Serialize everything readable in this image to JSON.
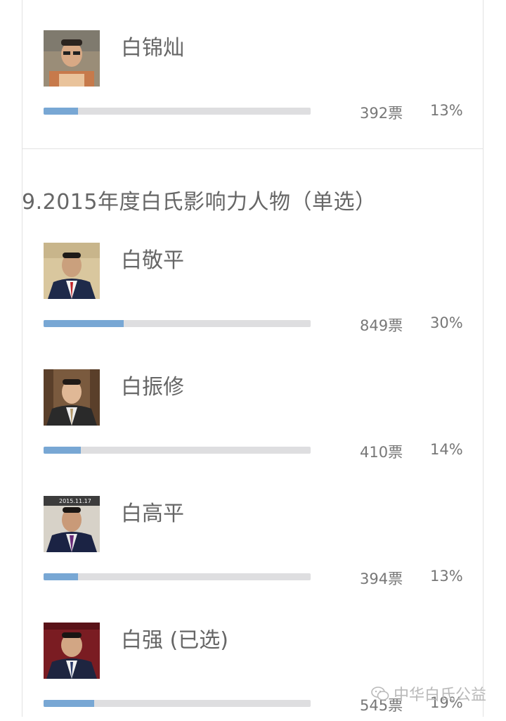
{
  "previous_question": {
    "candidates": [
      {
        "name": "白锦灿",
        "votes": "392票",
        "percent": "13%",
        "share": 0.13
      }
    ]
  },
  "question": {
    "title": "9.2015年度白氏影响力人物（单选）",
    "candidates": [
      {
        "name": "白敬平",
        "votes": "849票",
        "percent": "30%",
        "share": 0.3
      },
      {
        "name": "白振修",
        "votes": "410票",
        "percent": "14%",
        "share": 0.14
      },
      {
        "name": "白高平",
        "votes": "394票",
        "percent": "13%",
        "share": 0.13,
        "photo_stamp": "2015.11.17"
      },
      {
        "name": "白强 (已选)",
        "votes": "545票",
        "percent": "19%",
        "share": 0.19
      }
    ]
  },
  "watermark": {
    "text": "中华白氏公益",
    "icon": "wechat-icon"
  },
  "colors": {
    "bar_fill": "#78a7d4",
    "bar_track": "#dedee0",
    "text": "#666666"
  }
}
